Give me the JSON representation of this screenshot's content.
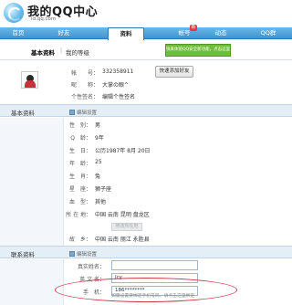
{
  "header": {
    "title": "我的QQ中心",
    "url": "id.qq.com"
  },
  "nav": {
    "items": [
      {
        "label": "首页"
      },
      {
        "label": "好友"
      },
      {
        "label": "资料"
      },
      {
        "label": "帐号"
      },
      {
        "label": "动态"
      },
      {
        "label": "QQ群"
      }
    ],
    "badge": "新"
  },
  "subtabs": {
    "basic": "基本资料",
    "sep": "|",
    "level": "我的等级",
    "green_button": "快来体验QQ安全新功能，点击这里"
  },
  "profile": {
    "account_label": "帐　　号：",
    "account_value": "332358911",
    "nickname_label": "昵　　称：",
    "nickname_value": "大掌の眼^",
    "signature_label": "个性签名：",
    "signature_value": "编辑个性签名",
    "quick_button": "快速添加好友"
  },
  "basic_section": {
    "title": "基本资料",
    "edit": "编辑设置"
  },
  "basic_fields": [
    {
      "label": "性　别：",
      "value": "男"
    },
    {
      "label": "Q　龄：",
      "value": "9年"
    },
    {
      "label": "生　日：",
      "value": "公历1987年 8月 20日"
    },
    {
      "label": "年　龄：",
      "value": "25"
    },
    {
      "label": "生　肖：",
      "value": "兔"
    },
    {
      "label": "星　座：",
      "value": "狮子座"
    },
    {
      "label": "血　型：",
      "value": "其他"
    },
    {
      "label": "所 在 地：",
      "value": "中国  云南  昆明  盘龙区"
    },
    {
      "label": "故　乡：",
      "value": "中国  云南  丽江  永胜县"
    }
  ],
  "location_button": "修改所在地",
  "contact_section": {
    "title": "联系资料",
    "edit": "编辑设置"
  },
  "contact_fields": [
    {
      "label": "真实姓名：",
      "value": ""
    },
    {
      "label": "英 文 名：",
      "value": "Jcy"
    },
    {
      "label": "手　机：",
      "value": "186********"
    }
  ],
  "contact_hint": "如需设置要绑定手机号码，请点击这里绑定"
}
